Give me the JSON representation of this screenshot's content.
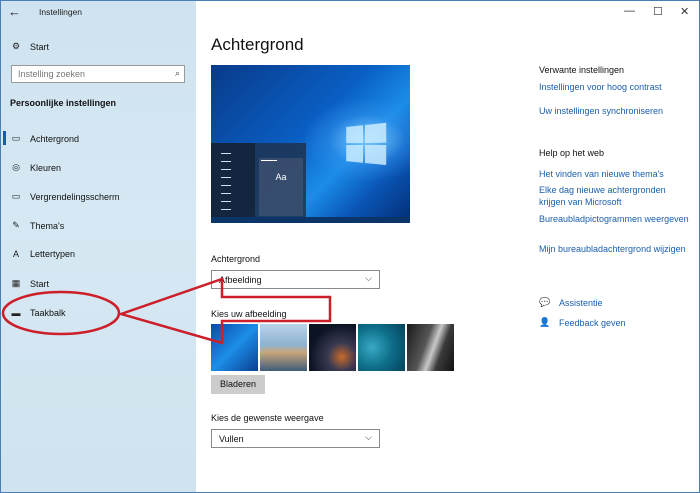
{
  "window": {
    "title": "Instellingen",
    "controls": [
      "—",
      "☐",
      "✕"
    ]
  },
  "sidebar": {
    "back_icon": "←",
    "home": {
      "label": "Start",
      "icon": "⚙"
    },
    "search": {
      "placeholder": "Instelling zoeken",
      "icon": "⌕"
    },
    "section": "Persoonlijke instellingen",
    "items": [
      {
        "label": "Achtergrond",
        "icon": "▭"
      },
      {
        "label": "Kleuren",
        "icon": "◎"
      },
      {
        "label": "Vergrendelingsscherm",
        "icon": "▭"
      },
      {
        "label": "Thema's",
        "icon": "✎"
      },
      {
        "label": "Lettertypen",
        "icon": "A"
      },
      {
        "label": "Start",
        "icon": "▦"
      },
      {
        "label": "Taakbalk",
        "icon": "▬"
      }
    ]
  },
  "main": {
    "title": "Achtergrond",
    "preview_sample": "Aa",
    "background_label": "Achtergrond",
    "background_value": "Afbeelding",
    "choose_label": "Kies uw afbeelding",
    "browse_button": "Bladeren",
    "fit_label": "Kies de gewenste weergave",
    "fit_value": "Vullen",
    "chevron": "⌵"
  },
  "related": {
    "title": "Verwante instellingen",
    "links": [
      "Instellingen voor hoog contrast",
      "Uw instellingen synchroniseren"
    ]
  },
  "help": {
    "title": "Help op het web",
    "links": [
      "Het vinden van nieuwe thema's",
      "Elke dag nieuwe achtergronden krijgen van Microsoft",
      "Bureaubladpictogrammen weergeven",
      "Mijn bureaubladachtergrond wijzigen"
    ]
  },
  "support": {
    "assist": {
      "label": "Assistentie",
      "icon": "💬"
    },
    "feedback": {
      "label": "Feedback geven",
      "icon": "👤"
    }
  },
  "colors": {
    "accent": "#1a5fae",
    "annotation": "#cc1f2a"
  }
}
